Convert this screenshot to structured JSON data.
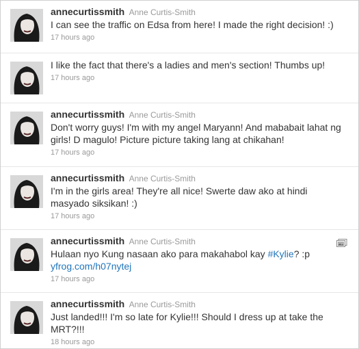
{
  "tweets": [
    {
      "screen_name": "annecurtissmith",
      "full_name": "Anne Curtis-Smith",
      "text": "I can see the traffic on Edsa from here! I made the right decision! :)",
      "time": "17 hours ago",
      "show_name": true
    },
    {
      "screen_name": "",
      "full_name": "",
      "text": "I like the fact that there's a ladies and men's section! Thumbs up!",
      "time": "17 hours ago",
      "show_name": false
    },
    {
      "screen_name": "annecurtissmith",
      "full_name": "Anne Curtis-Smith",
      "text": "Don't worry guys! I'm with my angel Maryann! And mababait lahat ng girls! D magulo! Picture picture taking lang at chikahan!",
      "time": "17 hours ago",
      "show_name": true
    },
    {
      "screen_name": "annecurtissmith",
      "full_name": "Anne Curtis-Smith",
      "text": "I'm in the girls area! They're all nice! Swerte daw ako at hindi masyado siksikan! :)",
      "time": "17 hours ago",
      "show_name": true
    },
    {
      "screen_name": "annecurtissmith",
      "full_name": "Anne Curtis-Smith",
      "text_before": "Hulaan nyo Kung nasaan ako para makahabol kay ",
      "hashtag": "#Kylie",
      "text_after": "? :p",
      "link": "yfrog.com/h07nytej",
      "time": "17 hours ago",
      "show_name": true,
      "has_media_icon": true,
      "media_icon": "image-gallery-icon"
    },
    {
      "screen_name": "annecurtissmith",
      "full_name": "Anne Curtis-Smith",
      "text": "Just landed!!! I'm so late for Kylie!!! Should I dress up at take the MRT?!!!",
      "time": "18 hours ago",
      "show_name": true
    }
  ],
  "colors": {
    "link": "#2276bb",
    "text": "#333333",
    "muted": "#999999",
    "divider": "#e6e6e6"
  }
}
